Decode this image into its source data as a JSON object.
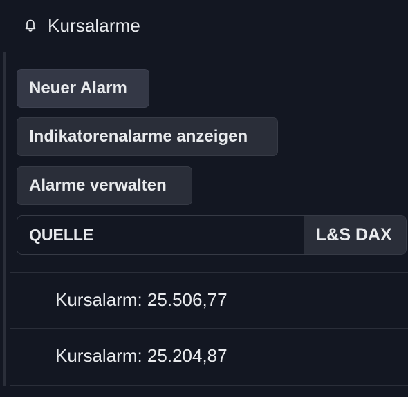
{
  "header": {
    "title": "Kursalarme",
    "icon": "bell-icon"
  },
  "actions": {
    "new_alarm": "Neuer Alarm",
    "show_indicator_alarms": "Indikatorenalarme anzeigen",
    "manage_alarms": "Alarme verwalten"
  },
  "source": {
    "label": "QUELLE",
    "value": "L&S DAX"
  },
  "alerts": [
    {
      "label": "Kursalarm: 25.506,77"
    },
    {
      "label": "Kursalarm: 25.204,87"
    }
  ],
  "colors": {
    "background": "#131722",
    "button": "#2a2e39",
    "border": "#363a45",
    "text": "#e8eaed"
  }
}
